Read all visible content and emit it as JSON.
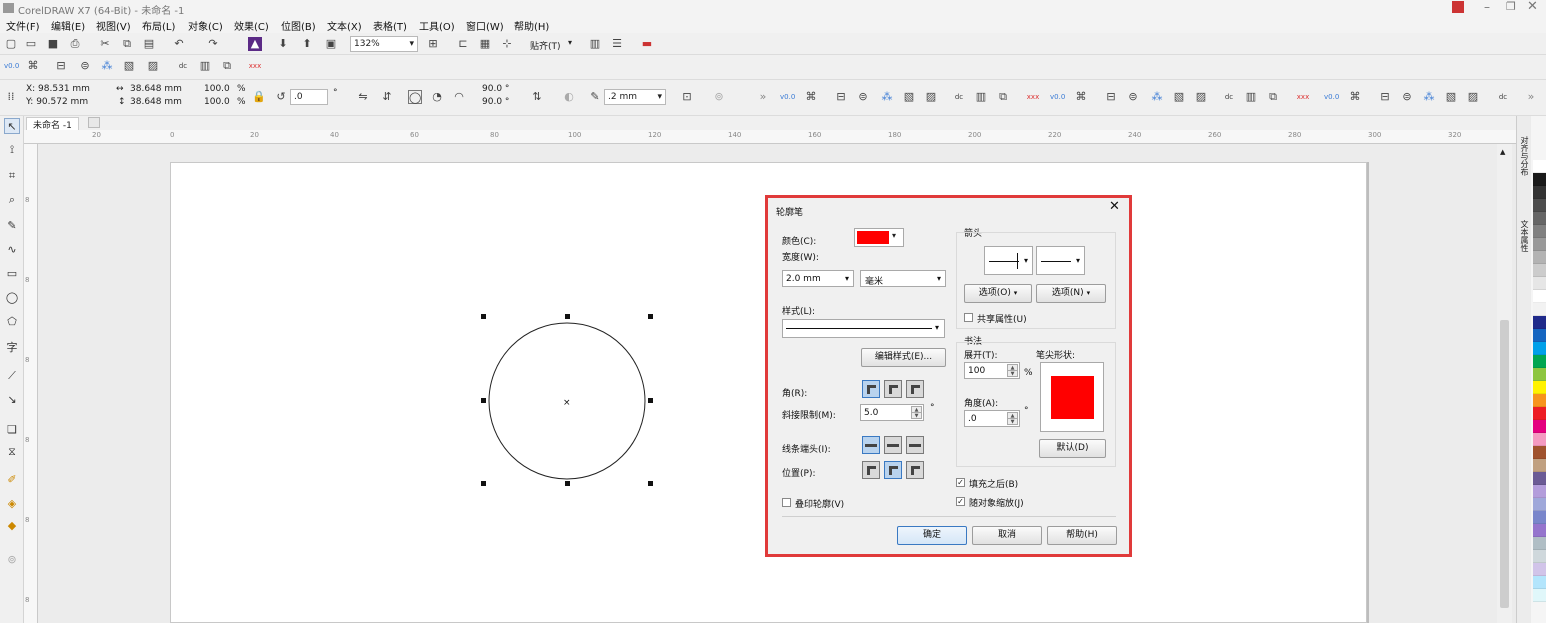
{
  "window": {
    "title": "CorelDRAW X7 (64-Bit) - 未命名 -1"
  },
  "menu": [
    "文件(F)",
    "编辑(E)",
    "视图(V)",
    "布局(L)",
    "对象(C)",
    "效果(C)",
    "位图(B)",
    "文本(X)",
    "表格(T)",
    "工具(O)",
    "窗口(W)",
    "帮助(H)"
  ],
  "toolbar": {
    "zoom": "132%",
    "snap": "贴齐(T)"
  },
  "property_bar": {
    "x": "X: 98.531 mm",
    "y": "Y: 90.572 mm",
    "w": "38.648 mm",
    "h": "38.648 mm",
    "scale_w": "100.0",
    "scale_h": "100.0",
    "pct": "%",
    "rotation": ".0",
    "deg": "°",
    "start_angle": "90.0 °",
    "end_angle": "90.0 °",
    "outline": ".2 mm"
  },
  "doc_tab": "未命名 -1",
  "ruler_h": [
    "20",
    "0",
    "20",
    "40",
    "60",
    "80",
    "100",
    "120",
    "140",
    "160",
    "180",
    "200",
    "220",
    "240",
    "260",
    "280",
    "300",
    "320"
  ],
  "ruler_v": [
    "8",
    "8",
    "8",
    "8",
    "8",
    "8",
    "8",
    "8",
    "8"
  ],
  "dock_tabs": [
    "对齐与分布",
    "文本属性"
  ],
  "palette": [
    "#ffffff",
    "#1a1a1a",
    "#333333",
    "#4d4d4d",
    "#666666",
    "#808080",
    "#999999",
    "#b3b3b3",
    "#cccccc",
    "#e6e6e6",
    "#ffffff",
    "#f2f2f2",
    "#1f2a8a",
    "#1565c0",
    "#00a0e9",
    "#00a651",
    "#8dc63f",
    "#fff200",
    "#f7941d",
    "#ed1c24",
    "#e4007f",
    "#f49ac1",
    "#a0522d",
    "#c0a080",
    "#6b5b95",
    "#b39ddb",
    "#9fa8da",
    "#7986cb",
    "#9575cd",
    "#b0bec5",
    "#cfd8dc",
    "#d1c4e9",
    "#b3e5fc",
    "#e0f7fa"
  ],
  "dialog": {
    "title": "轮廓笔",
    "color_label": "颜色(C):",
    "color_value": "#ff0000",
    "width_label": "宽度(W):",
    "width_value": "2.0 mm",
    "unit_value": "毫米",
    "style_label": "样式(L):",
    "edit_style_button": "编辑样式(E)...",
    "corner_label": "角(R):",
    "miter_label": "斜接限制(M):",
    "miter_value": "5.0",
    "miter_unit": "°",
    "line_cap_label": "线条端头(I):",
    "position_label": "位置(P):",
    "overprint_label": "叠印轮廓(V)",
    "arrows_label": "箭头",
    "options_left": "选项(O)",
    "options_right": "选项(N)",
    "share_attr_label": "共享属性(U)",
    "calligraphy_label": "书法",
    "stretch_label": "展开(T):",
    "stretch_value": "100",
    "stretch_unit": "%",
    "nib_label": "笔尖形状:",
    "angle_label": "角度(A):",
    "angle_value": ".0",
    "angle_unit": "°",
    "default_button": "默认(D)",
    "fill_behind_label": "填充之后(B)",
    "scale_with_label": "随对象缩放(J)",
    "ok_button": "确定",
    "cancel_button": "取消",
    "help_button": "帮助(H)",
    "close_glyph": "✕"
  }
}
